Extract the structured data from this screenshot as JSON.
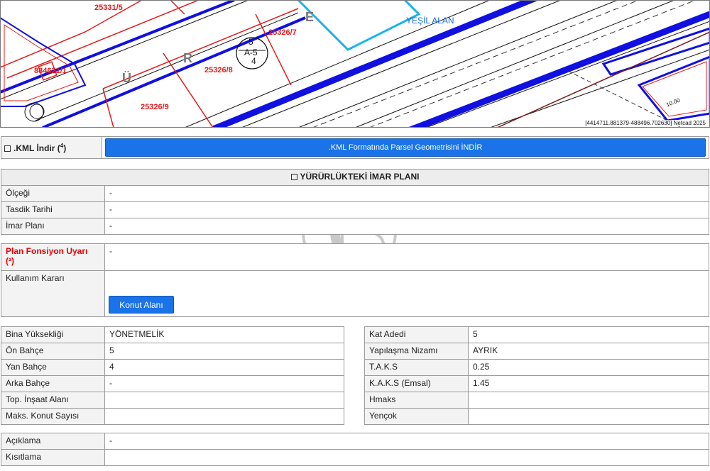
{
  "map": {
    "parcels": [
      "25331/5",
      "25326/7",
      "25326/8",
      "25326/9",
      "884621/1"
    ],
    "street_letters": [
      "R",
      "Ü",
      "E"
    ],
    "zone_label": "YEŞİL ALAN",
    "plan_code": "A-5",
    "plan_top": "5",
    "plan_bottom": "4",
    "scale_note": "10.00",
    "coordinate_text": "[4414711.881379-488496.702630] Netcad 2025"
  },
  "kml": {
    "label": ".KML İndir (",
    "sup": "4",
    "label_end": ")",
    "button_label": ".KML Formatında Parsel Geometrisini İNDİR"
  },
  "imar": {
    "title": "YÜRÜRLÜKTEKİ İMAR PLANI",
    "rows": [
      {
        "label": "Ölçeği",
        "value": "-"
      },
      {
        "label": "Tasdik Tarihi",
        "value": "-"
      },
      {
        "label": "İmar Planı",
        "value": "-"
      }
    ]
  },
  "fonksiyon": {
    "label": "Plan Fonsiyon Uyarı",
    "sup": "(²)",
    "value": "-",
    "kullanim_label": "Kullanım Kararı",
    "konut_button": "Konut Alanı"
  },
  "bina": [
    {
      "label": "Bina Yüksekliği",
      "value": "YÖNETMELİK"
    },
    {
      "label": "Ön Bahçe",
      "value": "5"
    },
    {
      "label": "Yan Bahçe",
      "value": "4"
    },
    {
      "label": "Arka Bahçe",
      "value": "-"
    },
    {
      "label": "Top. İnşaat Alanı",
      "value": ""
    },
    {
      "label": "Maks. Konut Sayısı",
      "value": ""
    }
  ],
  "kat": [
    {
      "label": "Kat Adedi",
      "value": "5"
    },
    {
      "label": "Yapılaşma Nizamı",
      "value": "AYRIK"
    },
    {
      "label": "T.A.K.S",
      "value": "0.25"
    },
    {
      "label": "K.A.K.S (Emsal)",
      "value": "1.45"
    },
    {
      "label": "Hmaks",
      "value": ""
    },
    {
      "label": "Yençok",
      "value": ""
    }
  ],
  "aciklama": [
    {
      "label": "Açıklama",
      "value": "-"
    },
    {
      "label": "Kısıtlama",
      "value": ""
    }
  ],
  "watermark": "SM"
}
